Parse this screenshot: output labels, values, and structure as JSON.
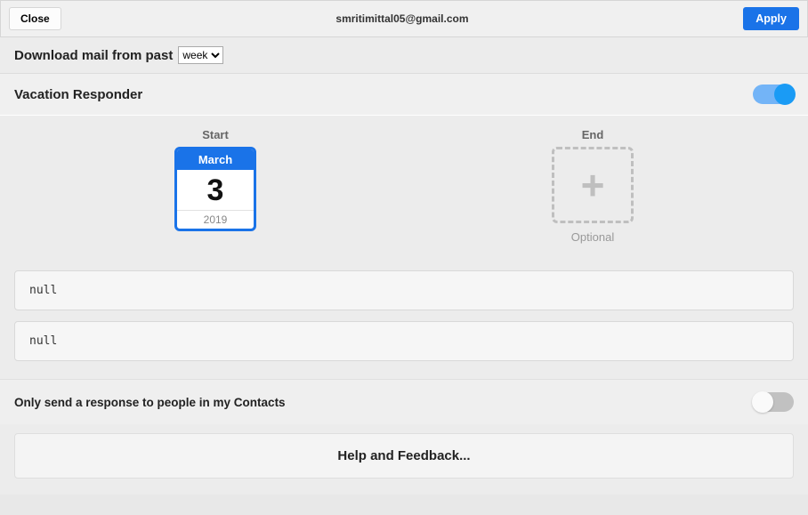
{
  "header": {
    "close": "Close",
    "email": "smritimittal05@gmail.com",
    "apply": "Apply"
  },
  "download": {
    "label": "Download mail from past",
    "selected": "week",
    "options": [
      "week"
    ]
  },
  "vacation": {
    "title": "Vacation Responder",
    "enabled": true,
    "start": {
      "caption": "Start",
      "month": "March",
      "day": "3",
      "year": "2019"
    },
    "end": {
      "caption": "End",
      "optional": "Optional"
    },
    "subject": "null",
    "body": "null"
  },
  "contacts": {
    "label": "Only send a response to people in my Contacts",
    "enabled": false
  },
  "help": {
    "label": "Help and Feedback..."
  }
}
